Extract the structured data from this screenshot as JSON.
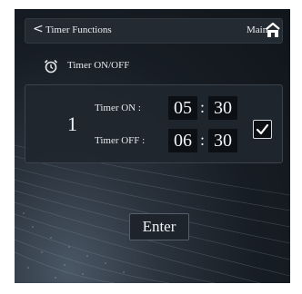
{
  "header": {
    "back_glyph": "<",
    "title": "Timer Functions",
    "main_label": "Main"
  },
  "section": {
    "icon": "alarm-clock-icon",
    "title": "Timer ON/OFF"
  },
  "timer": {
    "index": "1",
    "on_label": "Timer ON :",
    "off_label": "Timer OFF :",
    "on_hour": "05",
    "on_minute": "30",
    "off_hour": "06",
    "off_minute": "30",
    "separator": ":",
    "enabled": true
  },
  "enter_label": "Enter",
  "colors": {
    "background": "#10151b",
    "panel": "#20262e",
    "field": "#0c0f14",
    "text": "#e6e9ee"
  }
}
